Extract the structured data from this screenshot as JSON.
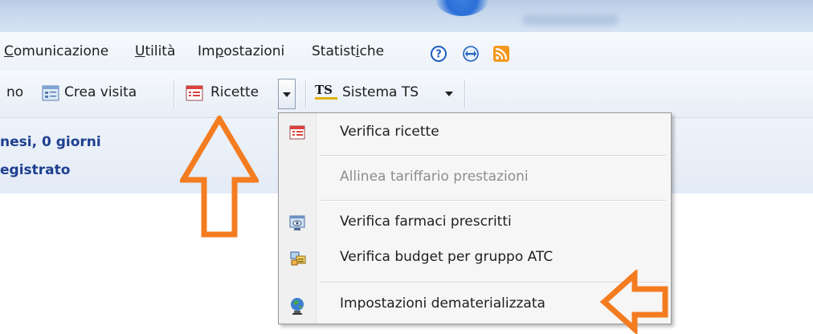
{
  "menubar": {
    "items": [
      {
        "pre": "",
        "ul": "C",
        "post": "omunicazione"
      },
      {
        "pre": "",
        "ul": "U",
        "post": "tilità"
      },
      {
        "pre": "Im",
        "ul": "p",
        "post": "ostazioni"
      },
      {
        "pre": "Statist",
        "ul": "i",
        "post": "che"
      }
    ]
  },
  "toolbar": {
    "partial_label": "no",
    "crea_visita": "Crea visita",
    "ricette": "Ricette",
    "sistema_ts": "Sistema TS",
    "ts_logo": "TS"
  },
  "info": {
    "line1": "nesi, 0 giorni",
    "line2": "egistrato"
  },
  "ricette_menu": {
    "items": [
      {
        "label": "Verifica ricette",
        "icon": "ricette-icon",
        "enabled": true
      },
      {
        "label": "Allinea tariffario prestazioni",
        "icon": "",
        "enabled": false
      },
      {
        "label": "Verifica farmaci prescritti",
        "icon": "monitor-eye-icon",
        "enabled": true
      },
      {
        "label": "Verifica budget per gruppo ATC",
        "icon": "budget-icon",
        "enabled": true
      },
      {
        "label": "Impostazioni dematerializzata",
        "icon": "globe-person-icon",
        "enabled": true
      }
    ]
  },
  "colors": {
    "accent_arrow": "#f47c20",
    "info_text": "#1d3f8f",
    "disabled_text": "#8d8d8d"
  }
}
